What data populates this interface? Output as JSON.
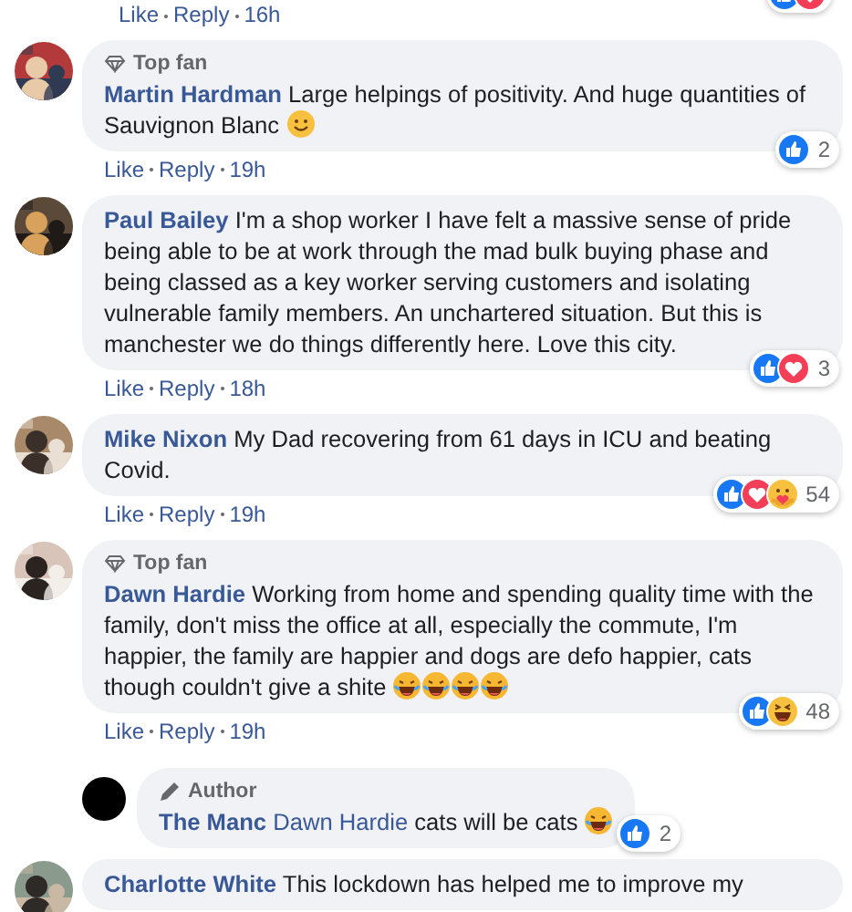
{
  "comments": [
    {
      "kind": "partial",
      "actions": {
        "like": "Like",
        "reply": "Reply",
        "time": "16h"
      },
      "reactions": {
        "types": [
          {
            "kind": "like"
          },
          {
            "kind": "love"
          }
        ]
      }
    },
    {
      "kind": "comment",
      "avatar": {
        "kind": "picture"
      },
      "badge": {
        "kind": "top_fan",
        "label": "Top fan"
      },
      "name": "Martin Hardman",
      "text": "Large helpings of positivity. And huge quantities of Sauvignon Blanc",
      "emojis": [
        {
          "kind": "smile"
        }
      ],
      "actions": {
        "like": "Like",
        "reply": "Reply",
        "time": "19h"
      },
      "reactions": {
        "types": [
          {
            "kind": "like"
          }
        ],
        "count": "2"
      }
    },
    {
      "kind": "comment",
      "avatar": {
        "kind": "picture"
      },
      "name": "Paul Bailey",
      "text": "I'm a shop worker I have felt a massive sense of pride being able to be at work through the mad bulk buying phase and being classed as a key worker serving customers and isolating vulnerable family members. An unchartered situation. But this is manchester we do things differently here. Love this city.",
      "actions": {
        "like": "Like",
        "reply": "Reply",
        "time": "18h"
      },
      "reactions": {
        "types": [
          {
            "kind": "like"
          },
          {
            "kind": "love"
          }
        ],
        "count": "3"
      }
    },
    {
      "kind": "comment",
      "avatar": {
        "kind": "picture"
      },
      "name": "Mike Nixon",
      "text": "My Dad recovering from 61 days in ICU and beating Covid.",
      "actions": {
        "like": "Like",
        "reply": "Reply",
        "time": "19h"
      },
      "reactions": {
        "types": [
          {
            "kind": "like"
          },
          {
            "kind": "love"
          },
          {
            "kind": "care"
          }
        ],
        "count": "54"
      }
    },
    {
      "kind": "comment",
      "avatar": {
        "kind": "picture"
      },
      "badge": {
        "kind": "top_fan",
        "label": "Top fan"
      },
      "name": "Dawn Hardie",
      "text": "Working from home and spending quality time with the family, don't miss the office at all, especially the commute, I'm happier, the family are happier and dogs are defo happier, cats though couldn't give a shite",
      "emojis": [
        {
          "kind": "laugh"
        },
        {
          "kind": "laugh"
        },
        {
          "kind": "laugh"
        },
        {
          "kind": "laugh"
        }
      ],
      "actions": {
        "like": "Like",
        "reply": "Reply",
        "time": "19h"
      },
      "reactions": {
        "types": [
          {
            "kind": "like"
          },
          {
            "kind": "haha"
          }
        ],
        "count": "48"
      },
      "replies": [
        {
          "kind": "reply",
          "avatar": {
            "kind": "logo"
          },
          "badge": {
            "kind": "author",
            "label": "Author"
          },
          "name": "The Manc",
          "mention": "Dawn Hardie",
          "text": "cats will be cats",
          "emojis": [
            {
              "kind": "laugh"
            }
          ],
          "reactions": {
            "types": [
              {
                "kind": "like"
              }
            ],
            "count": "2"
          }
        }
      ]
    },
    {
      "kind": "comment",
      "avatar": {
        "kind": "picture"
      },
      "name": "Charlotte White",
      "text": "This lockdown has helped me to improve my"
    }
  ]
}
